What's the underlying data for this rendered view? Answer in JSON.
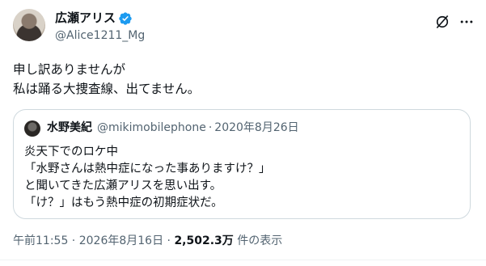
{
  "author": {
    "display_name": "広瀬アリス",
    "handle": "@Alice1211_Mg",
    "verified_color": "#1d9bf0"
  },
  "tweet": {
    "lines": [
      "申し訳ありませんが",
      "私は踊る大捜査線、出てません。"
    ]
  },
  "quoted": {
    "display_name": "水野美紀",
    "handle": "@mikimobilephone",
    "separator": "·",
    "date": "2020年8月26日",
    "lines": [
      "炎天下でのロケ中",
      "「水野さんは熱中症になった事ありますけ？」",
      "と聞いてきた広瀬アリスを思い出す。",
      "「け？」はもう熱中症の初期症状だ。"
    ]
  },
  "meta": {
    "time": "午前11:55",
    "sep1": " · ",
    "date": "2026年8月16日",
    "sep2": " · ",
    "views_count": "2,502.3万",
    "views_label": " 件の表示"
  },
  "icons": {
    "grok": "grok-icon",
    "more": "more-options-icon",
    "verified": "verified-badge-icon"
  }
}
